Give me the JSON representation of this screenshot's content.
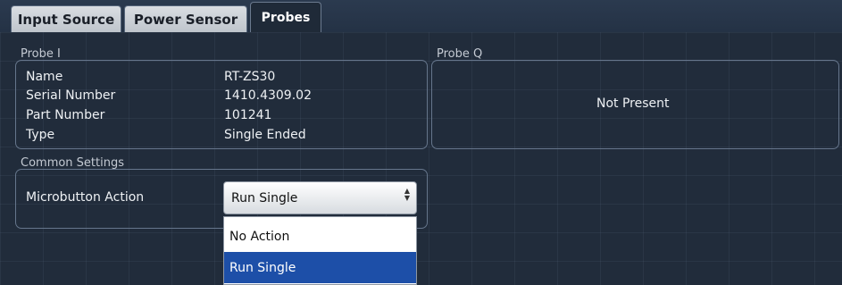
{
  "tabs": [
    {
      "label": "Input Source"
    },
    {
      "label": "Power Sensor"
    },
    {
      "label": "Probes"
    }
  ],
  "probe_i": {
    "title": "Probe I",
    "rows": [
      {
        "label": "Name",
        "value": "RT-ZS30"
      },
      {
        "label": "Serial Number",
        "value": "1410.4309.02"
      },
      {
        "label": "Part Number",
        "value": "101241"
      },
      {
        "label": "Type",
        "value": "Single Ended"
      }
    ]
  },
  "probe_q": {
    "title": "Probe Q",
    "status": "Not Present"
  },
  "common_settings": {
    "title": "Common Settings",
    "microbutton_label": "Microbutton Action",
    "microbutton_value": "Run Single",
    "options": [
      "No Action",
      "Run Single"
    ],
    "selected_option": "Run Single"
  },
  "colors": {
    "selected_option": "#1d4fa8",
    "background": "#1f2a38"
  }
}
